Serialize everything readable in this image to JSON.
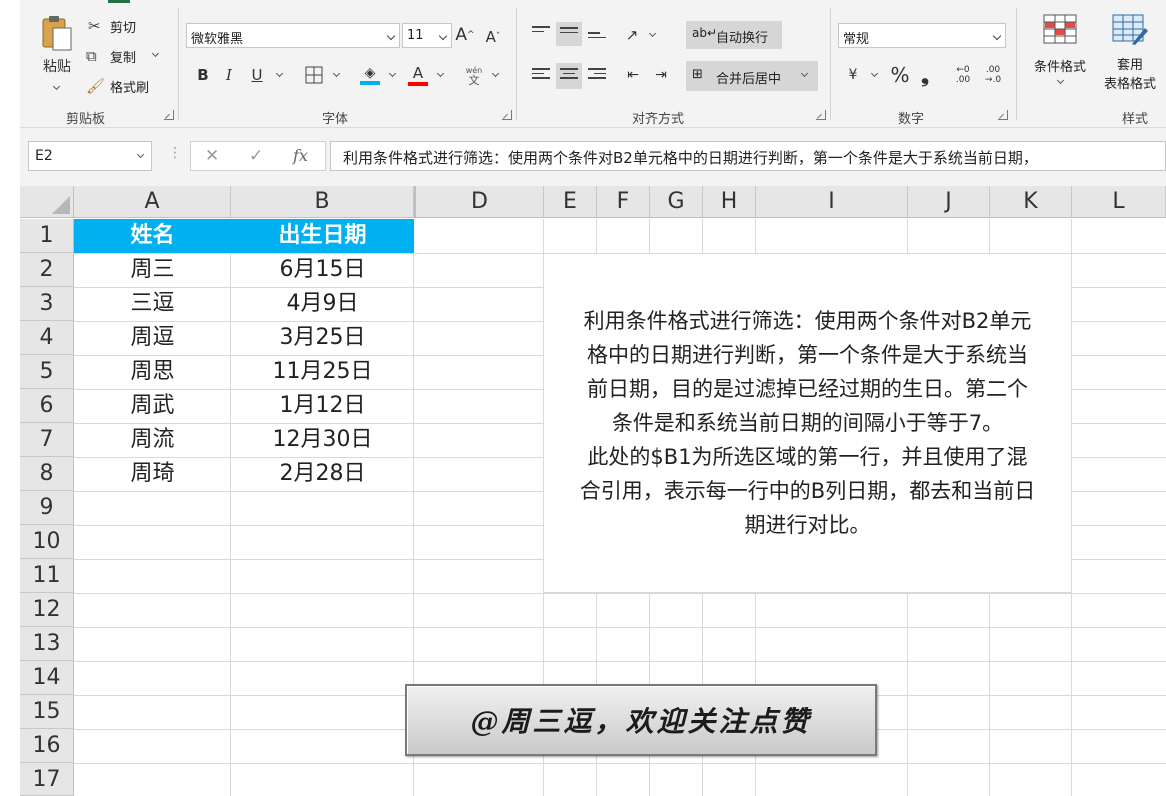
{
  "ribbon": {
    "clipboard": {
      "paste": "粘贴",
      "cut": "剪切",
      "copy": "复制",
      "format_painter": "格式刷",
      "group": "剪贴板"
    },
    "font": {
      "font_name": "微软雅黑",
      "font_size": "11",
      "grow": "A",
      "shrink": "A",
      "bold": "B",
      "italic": "I",
      "underline": "U",
      "font_color_letter": "A",
      "phonetic_top": "wén",
      "phonetic_bottom": "文",
      "group": "字体"
    },
    "alignment": {
      "wrap_text": "自动换行",
      "merge_center": "合并后居中",
      "group": "对齐方式"
    },
    "number": {
      "format": "常规",
      "percent": "%",
      "comma": "❟",
      "inc_decimal": "←0\n.00",
      "dec_decimal": ".00\n→.0",
      "group": "数字"
    },
    "styles": {
      "conditional_format": "条件格式",
      "table_format_1": "套用",
      "table_format_2": "表格格式",
      "group": "样式"
    }
  },
  "formula_bar": {
    "name_box": "E2",
    "cancel": "✕",
    "enter": "✓",
    "fx": "fx",
    "formula": "利用条件格式进行筛选：使用两个条件对B2单元格中的日期进行判断，第一个条件是大于系统当前日期，"
  },
  "sheet": {
    "columns": [
      "A",
      "B",
      "D",
      "E",
      "F",
      "G",
      "H",
      "I",
      "J",
      "K",
      "L"
    ],
    "rows": [
      "1",
      "2",
      "3",
      "4",
      "5",
      "6",
      "7",
      "8",
      "9",
      "10",
      "11",
      "12",
      "13",
      "14",
      "15",
      "16",
      "17"
    ],
    "header": {
      "name": "姓名",
      "birthday": "出生日期"
    },
    "data": [
      {
        "name": "周三",
        "birthday": "6月15日"
      },
      {
        "name": "三逗",
        "birthday": "4月9日"
      },
      {
        "name": "周逗",
        "birthday": "3月25日"
      },
      {
        "name": "周思",
        "birthday": "11月25日"
      },
      {
        "name": "周武",
        "birthday": "1月12日"
      },
      {
        "name": "周流",
        "birthday": "12月30日"
      },
      {
        "name": "周琦",
        "birthday": "2月28日"
      }
    ],
    "note_lines": [
      "利用条件格式进行筛选：使用两个条件对B2单元",
      "格中的日期进行判断，第一个条件是大于系统当",
      "前日期，目的是过滤掉已经过期的生日。第二个",
      "条件是和系统当前日期的间隔小于等于7。",
      "此处的$B1为所选区域的第一行，并且使用了混",
      "合引用，表示每一行中的B列日期，都去和当前日",
      "期进行对比。"
    ],
    "banner": "@周三逗，欢迎关注点赞"
  },
  "colors": {
    "header_fill": "#00b0f0",
    "header_text": "#ffffff",
    "ribbon_bg": "#f3f3f3",
    "excel_green": "#217346"
  }
}
